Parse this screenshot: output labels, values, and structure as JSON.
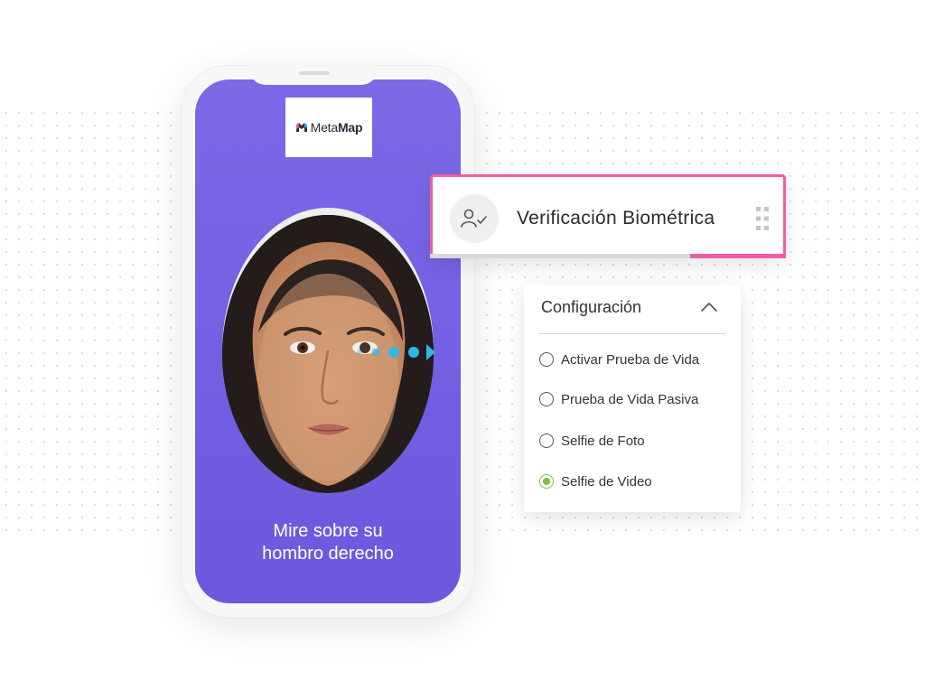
{
  "phone": {
    "logo_text_regular": "Meta",
    "logo_text_bold": "Map",
    "caption_line1": "Mire sobre su",
    "caption_line2": "hombro derecho"
  },
  "card": {
    "title": "Verificación Biométrica",
    "icon": "user-check-icon",
    "progress": 0.27
  },
  "config": {
    "title": "Configuración",
    "options": [
      {
        "label": "Activar Prueba de Vida",
        "selected": false
      },
      {
        "label": "Prueba de Vida Pasiva",
        "selected": false
      },
      {
        "label": "Selfie de Foto",
        "selected": false
      },
      {
        "label": "Selfie de Video",
        "selected": true
      }
    ]
  },
  "colors": {
    "screen": "#7561e4",
    "card_accent": "#ec5fa3",
    "radio_selected": "#7cc241",
    "eye_indicator": "#2fb7e8"
  }
}
